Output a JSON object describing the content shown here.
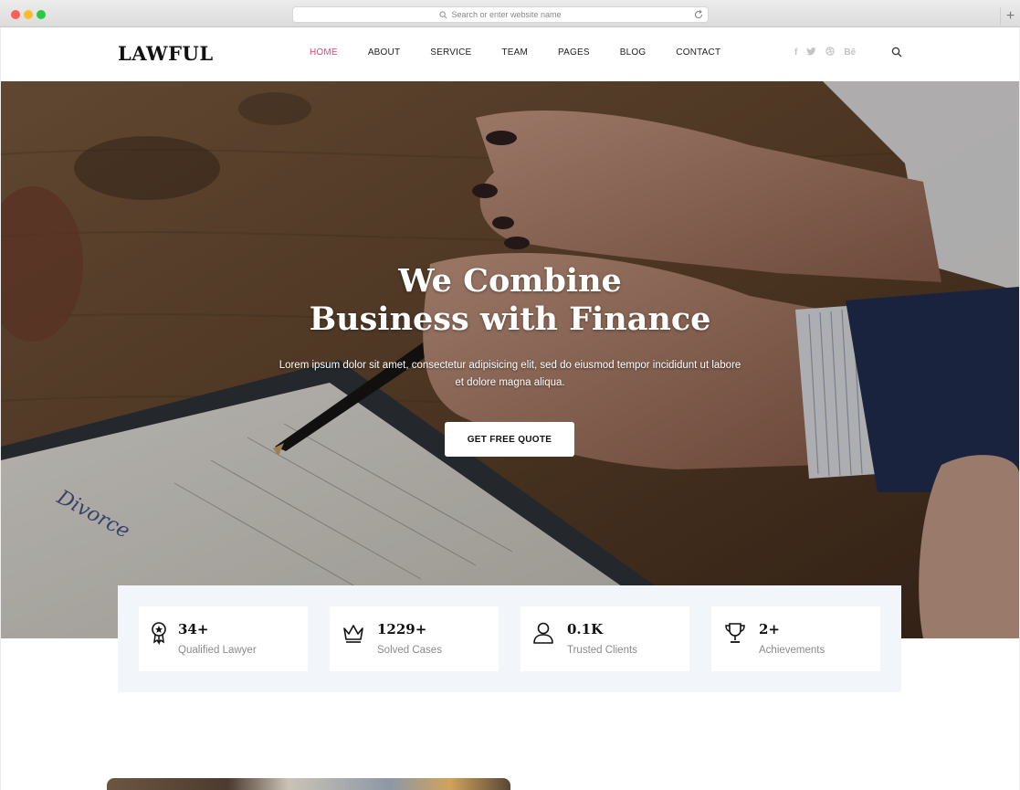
{
  "browser": {
    "url_placeholder": "Search or enter website name",
    "new_tab_label": "+"
  },
  "nav": {
    "logo": "LAWFUL",
    "items": [
      {
        "label": "HOME",
        "active": true
      },
      {
        "label": "ABOUT"
      },
      {
        "label": "SERVICE"
      },
      {
        "label": "TEAM"
      },
      {
        "label": "PAGES"
      },
      {
        "label": "BLOG"
      },
      {
        "label": "CONTACT"
      }
    ],
    "socials": [
      {
        "icon": "facebook-icon",
        "glyph": "f"
      },
      {
        "icon": "twitter-icon",
        "glyph": "🐦"
      },
      {
        "icon": "dribbble-icon",
        "glyph": "◎"
      },
      {
        "icon": "behance-icon",
        "glyph": "Bē"
      }
    ],
    "accent_color": "#e8407a"
  },
  "hero": {
    "title_line1": "We Combine",
    "title_line2": "Business with Finance",
    "description": "Lorem ipsum dolor sit amet, consectetur adipisicing elit, sed do eiusmod tempor incididunt ut labore et dolore magna aliqua.",
    "cta_label": "GET FREE QUOTE"
  },
  "stats": [
    {
      "icon": "award-icon",
      "value": "34+",
      "label": "Qualified Lawyer"
    },
    {
      "icon": "crown-icon",
      "value": "1229+",
      "label": "Solved Cases"
    },
    {
      "icon": "user-icon",
      "value": "0.1K",
      "label": "Trusted Clients"
    },
    {
      "icon": "trophy-icon",
      "value": "2+",
      "label": "Achievements"
    }
  ]
}
